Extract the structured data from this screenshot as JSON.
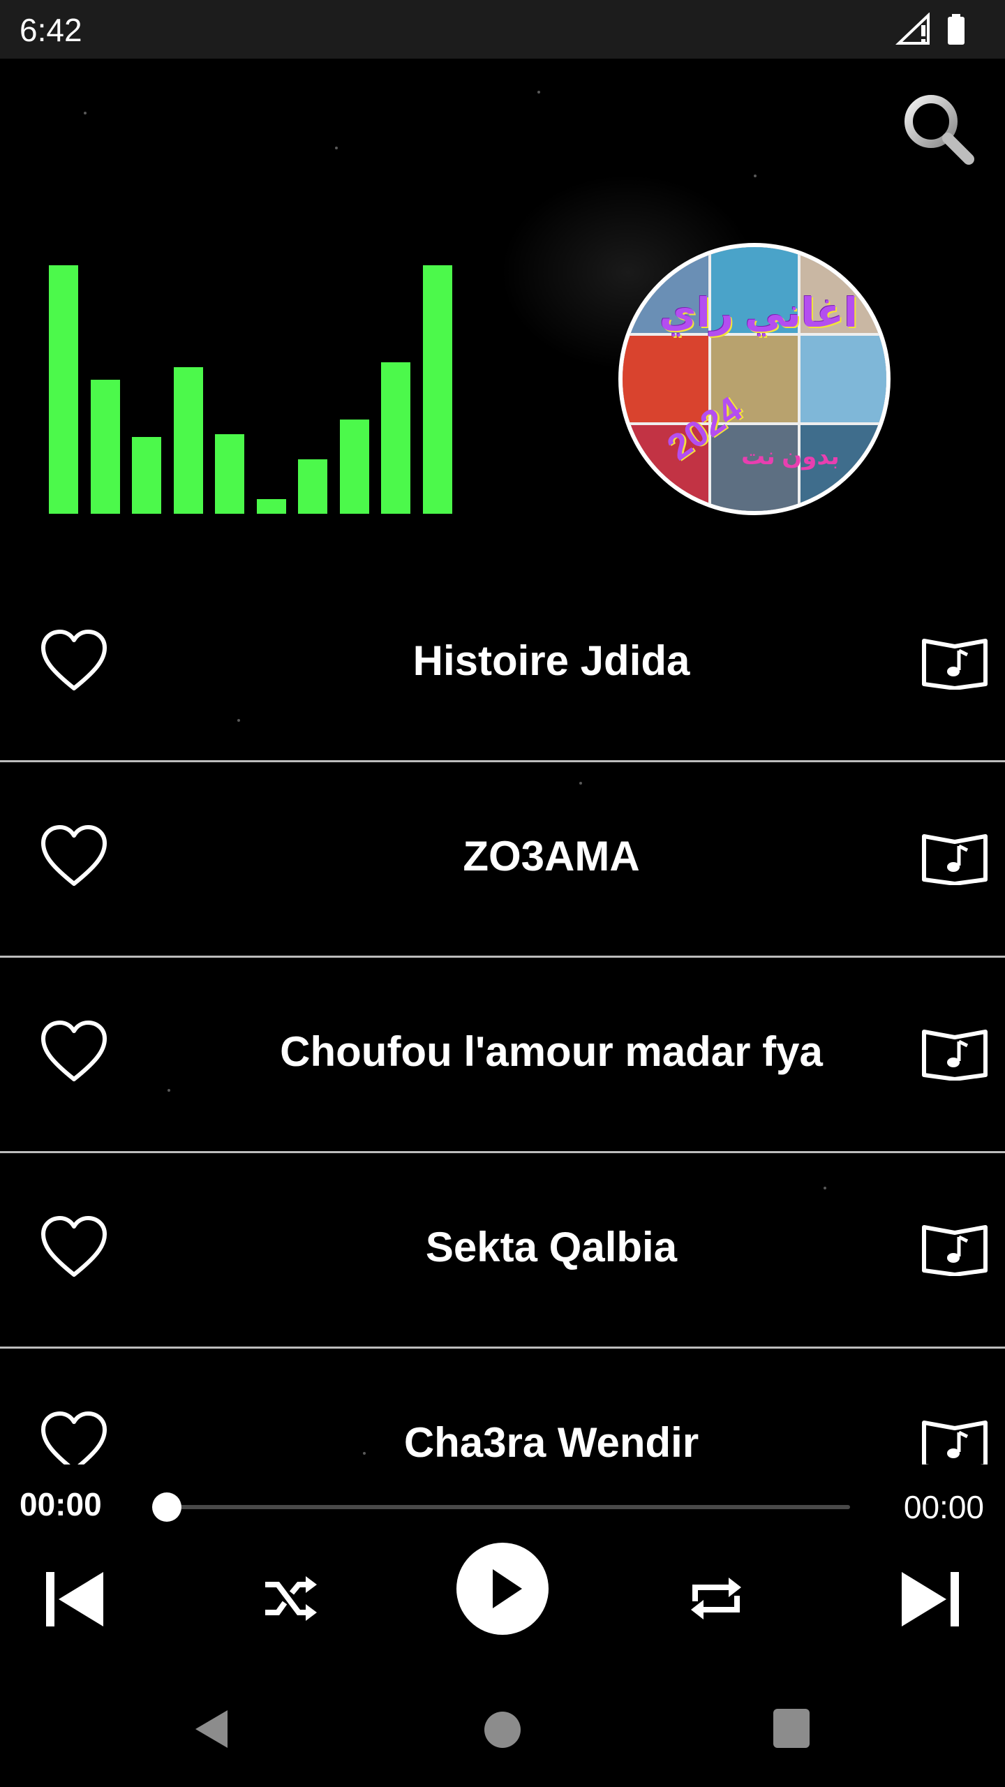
{
  "status_bar": {
    "time": "6:42",
    "icons": [
      "signal-icon",
      "battery-icon"
    ]
  },
  "header": {
    "search_icon": "search-icon"
  },
  "visualizer": {
    "levels": [
      1.0,
      0.54,
      0.31,
      0.59,
      0.32,
      0.06,
      0.22,
      0.38,
      0.61,
      1.0
    ],
    "color": "#4cf94b"
  },
  "cover": {
    "title": "اغاني راي",
    "year": "2024",
    "subtitle": "بدون نت"
  },
  "songs": [
    {
      "title": "Histoire Jdida"
    },
    {
      "title": "ZO3AMA"
    },
    {
      "title": "Choufou l'amour madar fya"
    },
    {
      "title": "Sekta Qalbia"
    },
    {
      "title": "Cha3ra Wendir"
    }
  ],
  "player": {
    "elapsed": "00:00",
    "total": "00:00",
    "progress": 0.0,
    "controls": [
      "previous-icon",
      "shuffle-icon",
      "play-icon",
      "repeat-icon",
      "next-icon"
    ]
  },
  "navigation": [
    "back-icon",
    "home-icon",
    "recents-icon"
  ]
}
